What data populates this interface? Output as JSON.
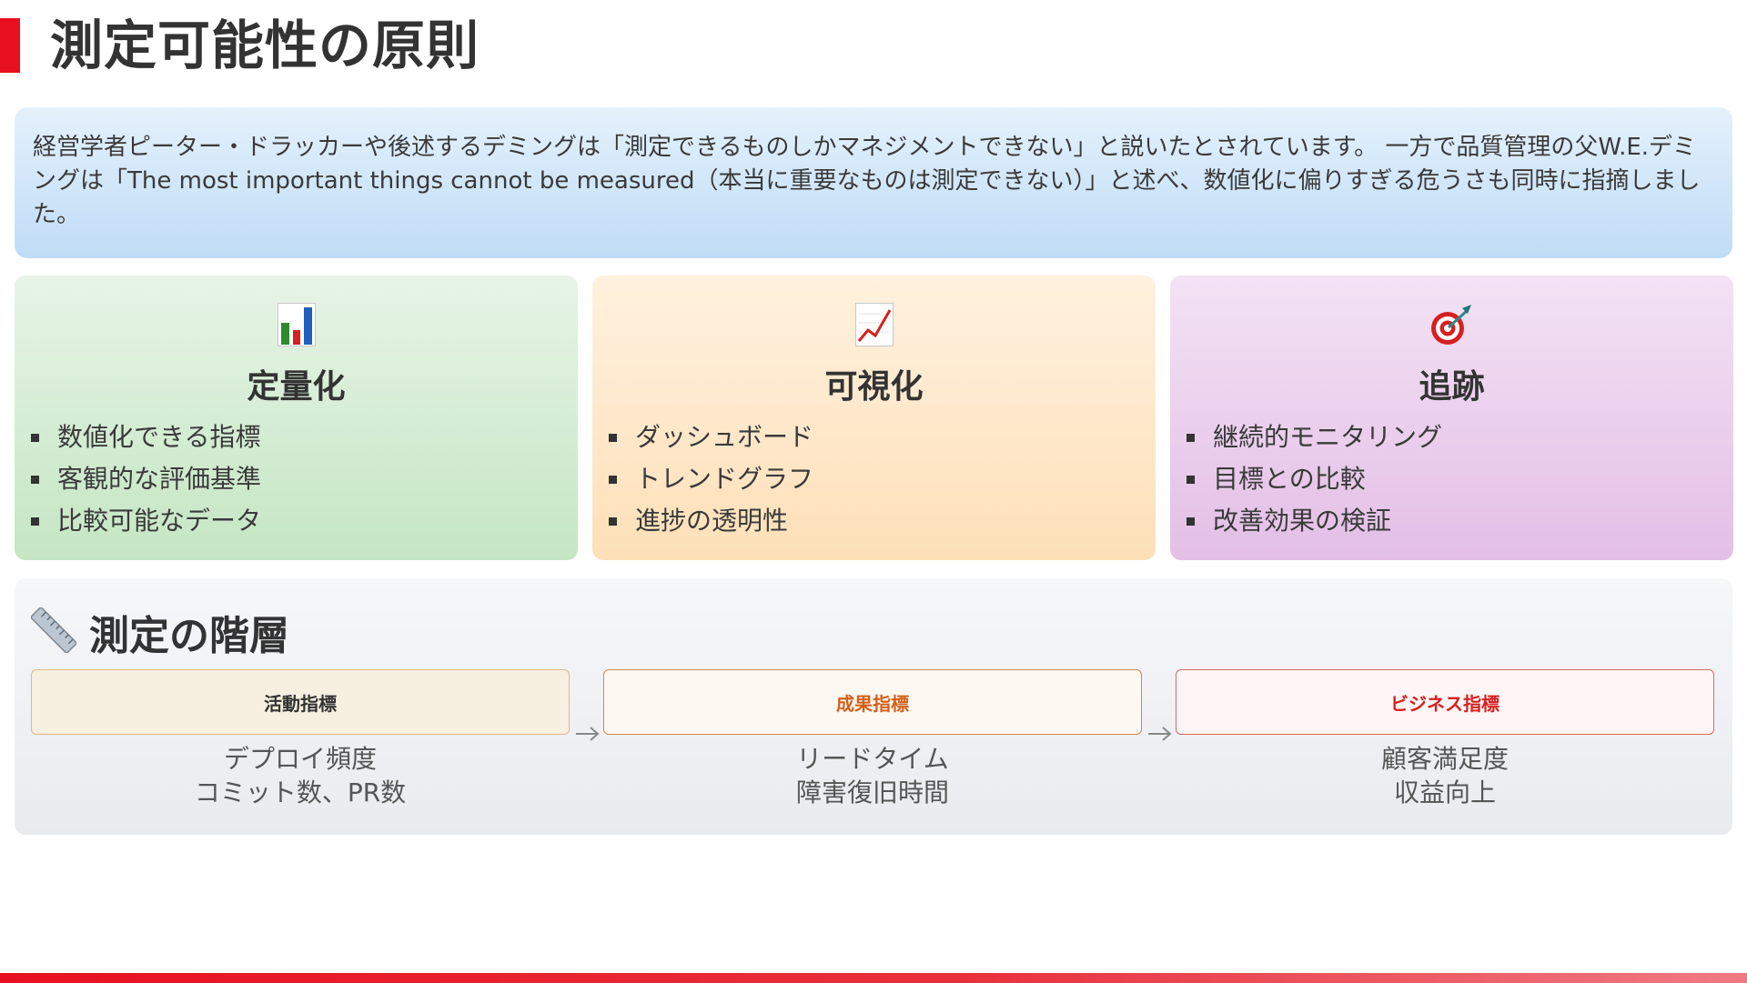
{
  "title": "測定可能性の原則",
  "intro": "経営学者ピーター・ドラッカーや後述するデミングは「測定できるものしかマネジメントできない」と説いたとされています。 一方で品質管理の父W.E.デミングは「The most important things cannot be measured（本当に重要なものは測定できない）」と述べ、数値化に偏りすぎる危うさも同時に指摘しました。",
  "cards": [
    {
      "icon": "bar-chart-icon",
      "title": "定量化",
      "items": [
        "数値化できる指標",
        "客観的な評価基準",
        "比較可能なデータ"
      ],
      "color": "#c5e6c4"
    },
    {
      "icon": "trend-chart-icon",
      "title": "可視化",
      "items": [
        "ダッシュボード",
        "トレンドグラフ",
        "進捗の透明性"
      ],
      "color": "#fde0b8"
    },
    {
      "icon": "target-icon",
      "title": "追跡",
      "items": [
        "継続的モニタリング",
        "目標との比較",
        "改善効果の検証"
      ],
      "color": "#e3bfe6"
    }
  ],
  "hierarchy": {
    "icon": "ruler-icon",
    "title": "測定の階層",
    "levels": [
      {
        "label": "活動指標",
        "lines": [
          "デプロイ頻度",
          "コミット数、PR数"
        ],
        "color": "#333333"
      },
      {
        "label": "成果指標",
        "lines": [
          "リードタイム",
          "障害復旧時間"
        ],
        "color": "#d2601a"
      },
      {
        "label": "ビジネス指標",
        "lines": [
          "顧客満足度",
          "収益向上"
        ],
        "color": "#d62020"
      }
    ],
    "arrow_icon": "arrow-right-icon"
  },
  "accent_color": "#e8101f"
}
